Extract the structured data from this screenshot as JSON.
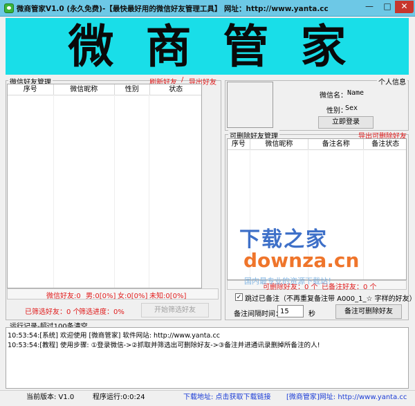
{
  "window": {
    "title": "微商管家V1.0 (永久免费)-【最快最好用的微信好友管理工具】 网址：http://www.yanta.cc",
    "min": "—",
    "max": "□",
    "close": "✕"
  },
  "banner": {
    "text": "微商管家"
  },
  "friends_panel": {
    "title": "微信好友管理",
    "refresh_link": "刷新好友",
    "separator": "/",
    "export_link": "导出好友",
    "columns": [
      "序号",
      "微信昵称",
      "性别",
      "状态"
    ],
    "stats": {
      "friends": "微信好友:0",
      "male": "男:0[0%]",
      "female": "女:0[0%]",
      "unknown": "未知:0[0%]"
    },
    "filtered": "已筛选好友：0 个",
    "progress": "筛选进度：0%",
    "filter_button": "开始筛选好友"
  },
  "profile": {
    "title": "个人信息",
    "name_label": "微信名：",
    "name_value": "Name",
    "gender_label": "性别：",
    "gender_value": "Sex",
    "login_button": "立即登录"
  },
  "deletable_panel": {
    "title": "可删除好友管理",
    "export_link": "导出可删除好友",
    "columns": [
      "序号",
      "微信昵称",
      "备注名称",
      "备注状态"
    ],
    "stats": {
      "deletable": "可删除好友：0 个",
      "remarked": "已备注好友：0 个"
    },
    "skip_checkbox_label": "跳过已备注（不再重复备注带 A000_1_☆ 字样的好友）",
    "skip_checked": true,
    "interval_label": "备注间隔时间：",
    "interval_value": "15",
    "interval_unit": "秒",
    "remark_button": "备注可删除好友"
  },
  "log": {
    "title": "运行记录-超过100条清空",
    "lines": [
      "10:53:54:[系统] 欢迎使用 [微商管家]  软件网站: http://www.yanta.cc",
      "10:53:54:[教程] 使用步骤: ①登录微信->②抓取并筛选出可删除好友->③备注并进通讯录删掉所备注的人!"
    ]
  },
  "statusbar": {
    "version": "当前版本: V1.0",
    "runtime": "程序运行:0:0:24",
    "download": "下载地址: 点击获取下载链接",
    "site": "[微商管家]网址: http://www.yanta.cc"
  },
  "watermark": {
    "cn": "下载之家",
    "en": "downza.cn",
    "sub": "国内最专业的资源下载站！"
  },
  "colors": {
    "banner_bg": "#19dee8",
    "titlebar_bg": "#6dc8e6",
    "accent_red": "#e01b1b",
    "link_blue": "#1a3bd6"
  }
}
